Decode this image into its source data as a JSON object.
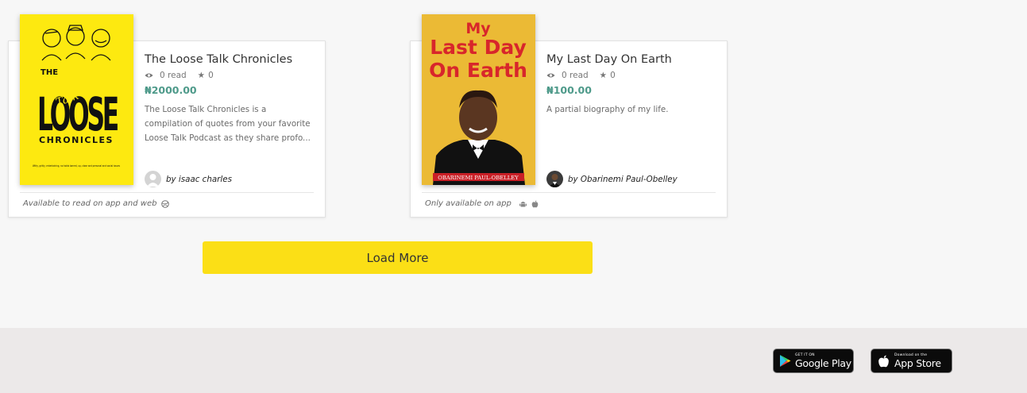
{
  "books": [
    {
      "title": "The Loose Talk Chronicles",
      "reads": "0 read",
      "rating": "0",
      "price": "₦2000.00",
      "description": "The Loose Talk Chronicles is a compilation of quotes from your favorite Loose Talk Podcast as they share profo...",
      "author": "by isaac charles",
      "availability": "Available to read on app and web",
      "cover": {
        "bg": "#fde910",
        "the": "THE",
        "talk": "Talk",
        "loose": "LOOSE",
        "chronicles": "CHRONICLES",
        "tagline": "Witty, gritty, entertaining, no holds barred, up, close and personal and social issues"
      }
    },
    {
      "title": "My Last Day On Earth",
      "reads": "0 read",
      "rating": "0",
      "price": "₦100.00",
      "description": "A partial biography of my life.",
      "author": "by Obarinemi Paul-Obelley",
      "availability": "Only available on app",
      "cover": {
        "bg": "#e8b331",
        "line1": "My",
        "line2": "Last Day",
        "line3": "On Earth",
        "banner": "OBARINEMI PAUL-OBELLEY"
      }
    }
  ],
  "load_more": "Load More",
  "stores": {
    "google_small": "GET IT ON",
    "google_big": "Google Play",
    "apple_small": "Download on the",
    "apple_big": "App Store"
  },
  "colors": {
    "accent": "#fbdf16",
    "price": "#4e9a8a",
    "footer": "#ece9e9"
  }
}
